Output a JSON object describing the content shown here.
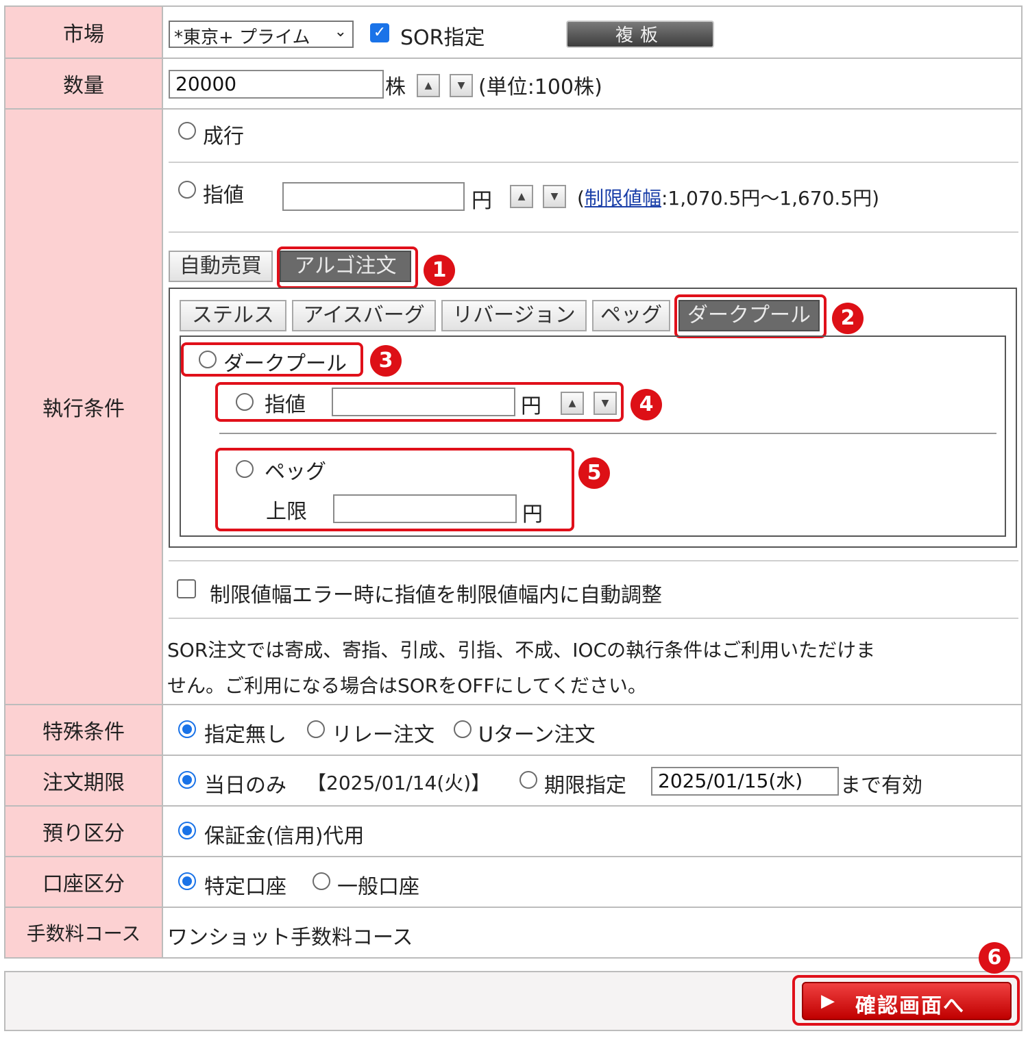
{
  "market": {
    "label": "市場",
    "select_value": "*東京+ プライム",
    "sor_checked": true,
    "sor_label": "SOR指定",
    "board_button": "複板"
  },
  "quantity": {
    "label": "数量",
    "value": "20000",
    "unit": "株",
    "note": "(単位:100株)"
  },
  "execution": {
    "label": "執行条件",
    "market_order": "成行",
    "limit_order": "指値",
    "limit_unit": "円",
    "price_range_open": "(",
    "price_range_link": "制限値幅",
    "price_range_text": ":1,070.5円〜1,670.5円)",
    "mode_tabs": [
      "自動売買",
      "アルゴ注文"
    ],
    "algo_tabs": [
      "ステルス",
      "アイスバーグ",
      "リバージョン",
      "ペッグ",
      "ダークプール"
    ],
    "darkpool_radio": "ダークプール",
    "dp_limit_label": "指値",
    "dp_limit_unit": "円",
    "peg_label": "ペッグ",
    "upper_label": "上限",
    "upper_unit": "円",
    "auto_adjust_label": "制限値幅エラー時に指値を制限値幅内に自動調整",
    "sor_note_line1": "SOR注文では寄成、寄指、引成、引指、不成、IOCの執行条件はご利用いただけま",
    "sor_note_line2": "せん。ご利用になる場合はSORをOFFにしてください。"
  },
  "special": {
    "label": "特殊条件",
    "options": [
      "指定無し",
      "リレー注文",
      "Uターン注文"
    ],
    "selected": "指定無し"
  },
  "period": {
    "label": "注文期限",
    "today": "当日のみ",
    "today_date": "【2025/01/14(火)】",
    "specify": "期限指定",
    "date_value": "2025/01/15(水)",
    "valid_until": "まで有効"
  },
  "deposit": {
    "label": "預り区分",
    "option": "保証金(信用)代用"
  },
  "account": {
    "label": "口座区分",
    "options": [
      "特定口座",
      "一般口座"
    ],
    "selected": "特定口座"
  },
  "fee": {
    "label": "手数料コース",
    "value": "ワンショット手数料コース"
  },
  "confirm_button": "確認画面へ",
  "callouts": [
    "1",
    "2",
    "3",
    "4",
    "5",
    "6"
  ],
  "colors": {
    "label_bg": "#fcd1d2",
    "callout_red": "#dd1016",
    "radio_blue": "#1a73e8",
    "active_tab": "#6a6a6a",
    "confirm_red": "#e0101a"
  }
}
